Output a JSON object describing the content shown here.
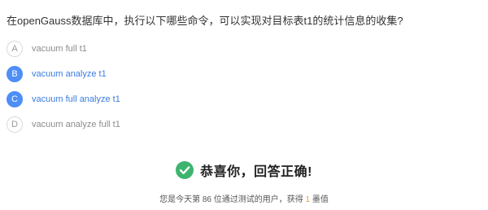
{
  "question": "在openGauss数据库中，执行以下哪些命令，可以实现对目标表t1的统计信息的收集?",
  "options": [
    {
      "letter": "A",
      "text": "vacuum full t1",
      "selected": false
    },
    {
      "letter": "B",
      "text": "vacuum analyze t1",
      "selected": true
    },
    {
      "letter": "C",
      "text": "vacuum full analyze t1",
      "selected": true
    },
    {
      "letter": "D",
      "text": "vacuum analyze full t1",
      "selected": false
    }
  ],
  "result": {
    "title": "恭喜你，回答正确!",
    "icon": "check-circle-icon"
  },
  "stats": {
    "prefix": "您是今天第",
    "rank": "86",
    "middle": "位通过测试的用户，获得",
    "reward": "1",
    "suffix": "墨值"
  },
  "colors": {
    "accent": "#4d8ef7",
    "success": "#3cb46e",
    "highlight": "#e8a03a"
  }
}
